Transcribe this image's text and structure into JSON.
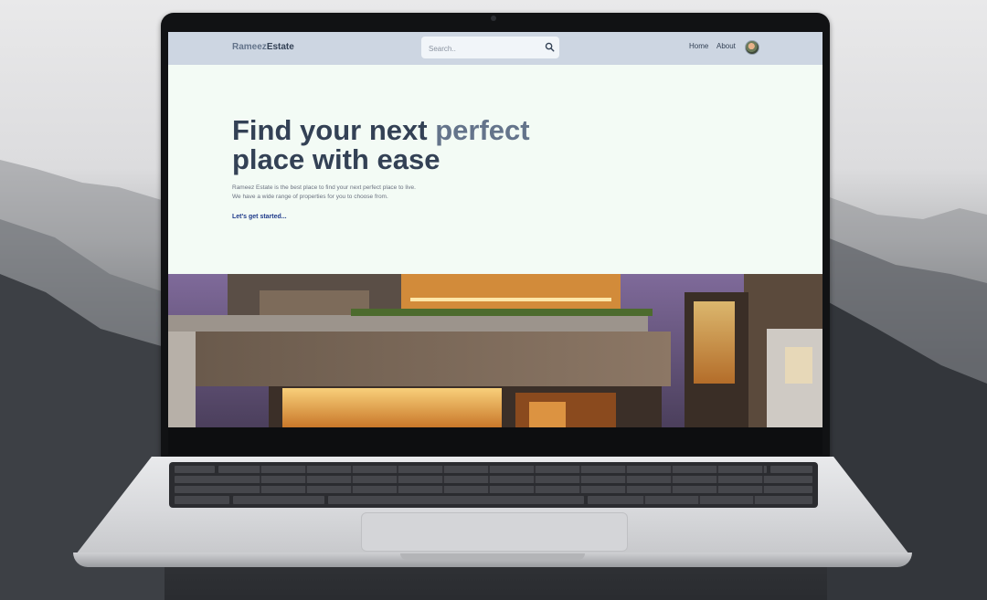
{
  "site": {
    "logo_part1": "Rameez",
    "logo_part2": "Estate"
  },
  "search": {
    "placeholder": "Search..",
    "icon": "search-icon"
  },
  "nav": {
    "links": [
      "Home",
      "About"
    ],
    "avatar_icon": "profile-avatar"
  },
  "hero": {
    "headline_part1": "Find your next",
    "headline_accent": "perfect",
    "headline_part2": "place with ease",
    "description_line1": "Rameez Estate is the best place to find your next perfect place to live.",
    "description_line2": "We have a wide range of properties for you to choose from.",
    "cta": "Let's get started..."
  },
  "colors": {
    "nav_bg": "#cdd6e2",
    "page_bg": "#f3fbf5",
    "headline": "#334155",
    "accent": "#64748b",
    "cta": "#1e3a8a"
  }
}
